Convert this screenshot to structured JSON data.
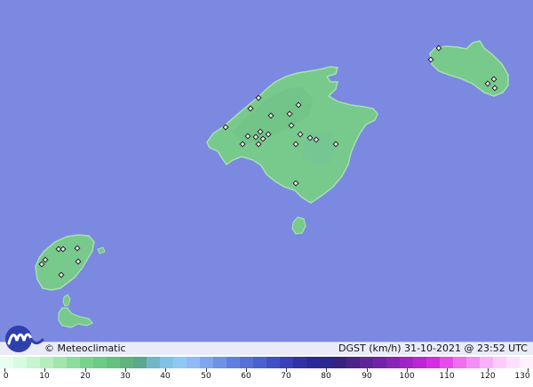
{
  "map": {
    "sea_color": "#7b89e0",
    "land_color": "#78c98c",
    "land_edge_color": "#a7e0b0",
    "islands": [
      "Mallorca",
      "Menorca",
      "Ibiza",
      "Formentera",
      "Cabrera"
    ],
    "station_count": 26
  },
  "footer": {
    "brand": "© Meteoclimatic",
    "variable": "DGST (km/h)",
    "date": "31-10-2021",
    "time": "23:52 UTC",
    "status": "DGST (km/h)   31-10-2021  @  23:52 UTC"
  },
  "legend": {
    "labels": [
      "0",
      "10",
      "20",
      "30",
      "40",
      "50",
      "60",
      "70",
      "80",
      "90",
      "100",
      "110",
      "120",
      "130"
    ],
    "unit": "km/h",
    "min": 0,
    "max": 130,
    "colors": [
      "#e6fff0",
      "#d6fbdf",
      "#c6f5cf",
      "#b4eebe",
      "#a0e6ac",
      "#8cdd9c",
      "#7ad38d",
      "#6ccb84",
      "#64c07e",
      "#5db47c",
      "#58a98e",
      "#6fb7c8",
      "#7ec3e6",
      "#8ec9f5",
      "#8fbaf5",
      "#7ea6ee",
      "#6d92e6",
      "#5f7fe0",
      "#5670d8",
      "#4b60d0",
      "#4150c5",
      "#3840b8",
      "#3232a8",
      "#2b2a9a",
      "#2a2790",
      "#37237f",
      "#4a2488",
      "#5e2598",
      "#7224a8",
      "#8a23b8",
      "#a223c8",
      "#bb25d6",
      "#d52de2",
      "#e84aea",
      "#f06df0",
      "#f48ef4",
      "#f8b0f8",
      "#fbccfb",
      "#fde0fd",
      "#fff0ff"
    ]
  }
}
